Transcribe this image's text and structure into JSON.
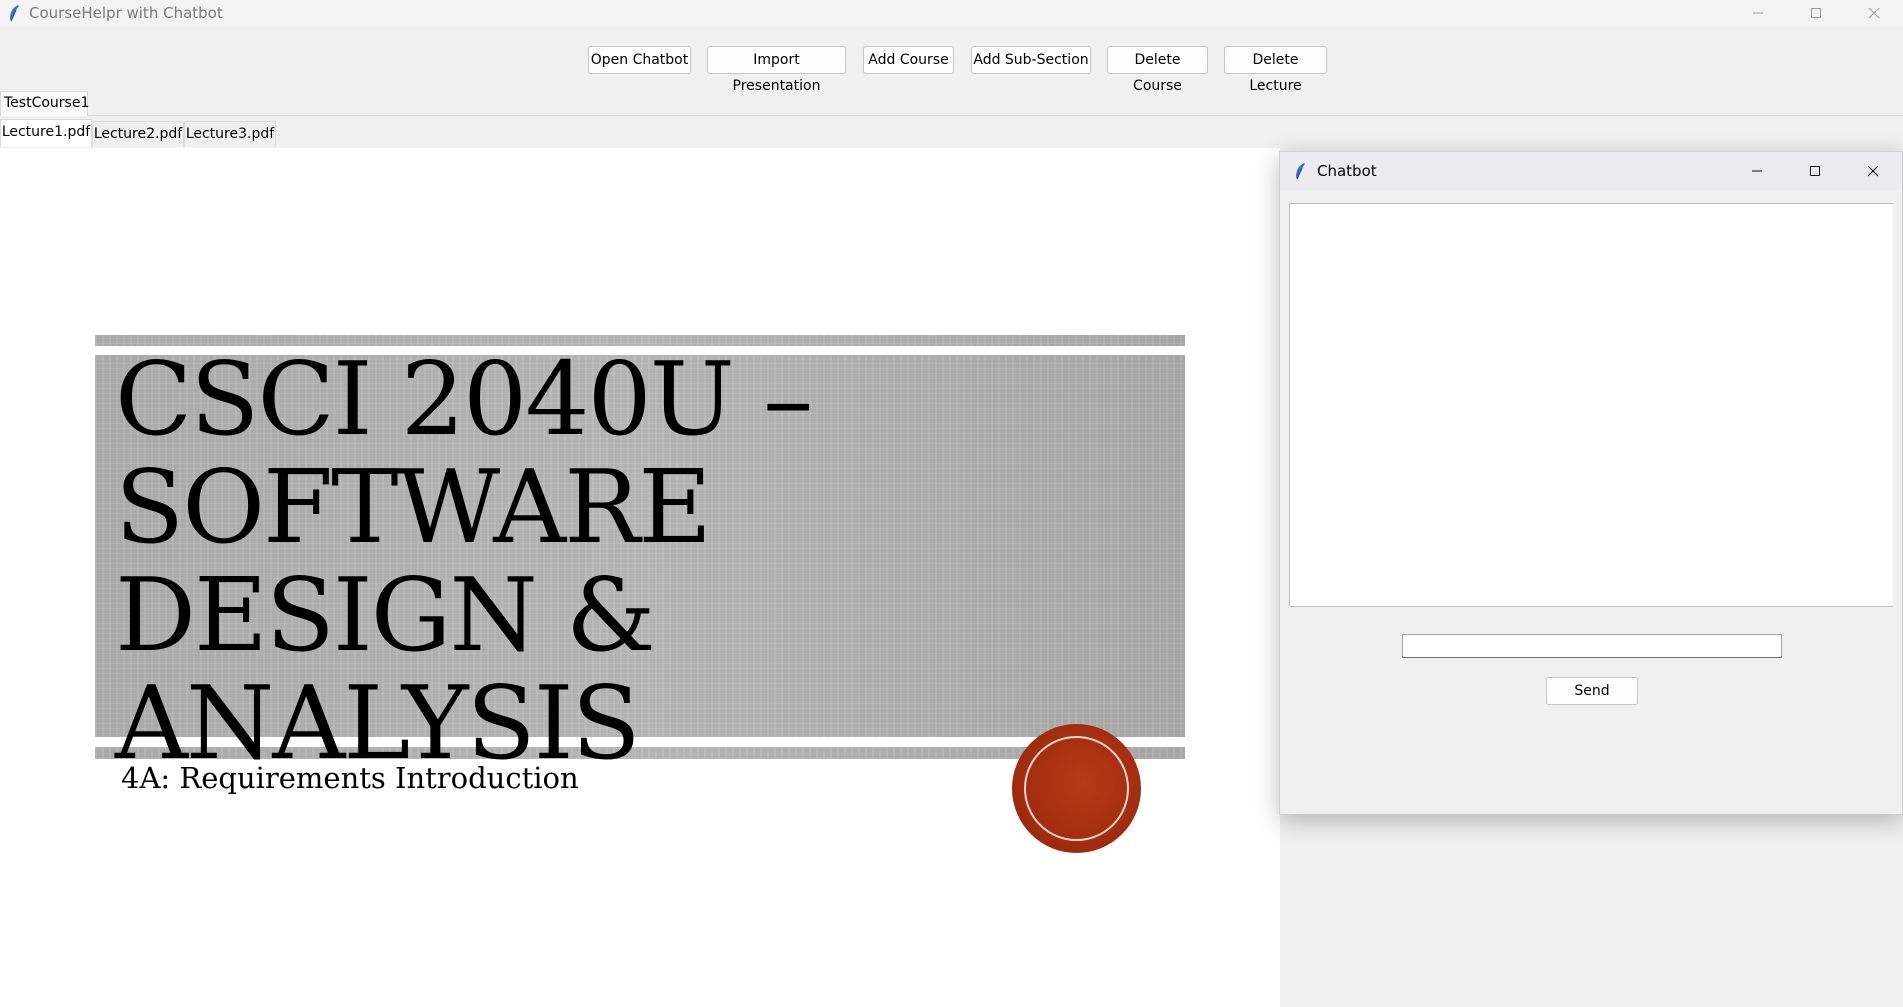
{
  "window": {
    "title": "CourseHelpr with Chatbot"
  },
  "toolbar": {
    "open_chatbot": "Open Chatbot",
    "import_presentation": "Import Presentation",
    "add_course": "Add Course",
    "add_subsection": "Add Sub-Section",
    "delete_course": "Delete Course",
    "delete_lecture": "Delete Lecture"
  },
  "courses": {
    "tabs": [
      "TestCourse1"
    ],
    "selected": "TestCourse1"
  },
  "lectures": {
    "tabs": [
      "Lecture1.pdf",
      "Lecture2.pdf",
      "Lecture3.pdf"
    ],
    "selected": "Lecture1.pdf"
  },
  "slide": {
    "title_lines": [
      "CSCI 2040U –",
      "Software",
      "Design &",
      "Analysis"
    ],
    "subtitle": "4A: Requirements Introduction",
    "accent_color": "#a12d0e"
  },
  "chatbot": {
    "title": "Chatbot",
    "log": "",
    "input_value": "",
    "send_label": "Send"
  },
  "icons": {
    "app": "feather-icon",
    "minimize": "minimize-icon",
    "maximize": "maximize-icon",
    "close": "close-icon"
  }
}
